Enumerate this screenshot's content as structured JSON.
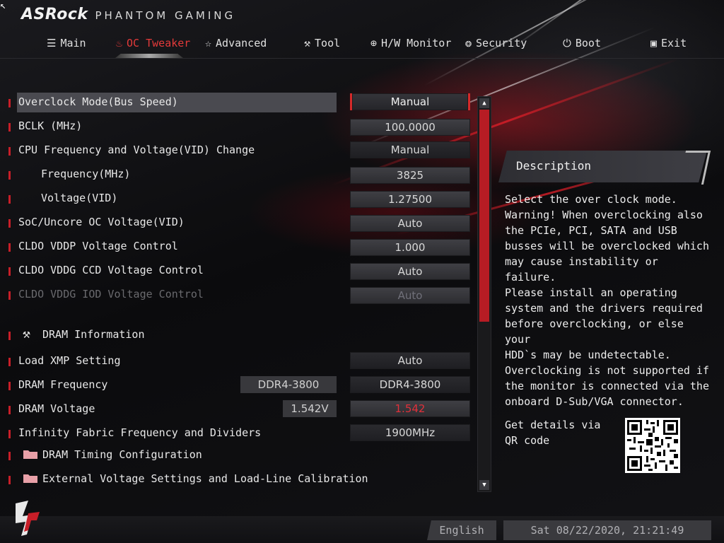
{
  "header": {
    "brand": "ASRock",
    "subtitle": "PHANTOM GAMING"
  },
  "nav": {
    "tabs": [
      {
        "label": "Main",
        "icon": "list-icon"
      },
      {
        "label": "OC Tweaker",
        "icon": "flame-icon",
        "active": true
      },
      {
        "label": "Advanced",
        "icon": "star-icon"
      },
      {
        "label": "Tool",
        "icon": "tools-icon"
      },
      {
        "label": "H/W Monitor",
        "icon": "crosshair-icon"
      },
      {
        "label": "Security",
        "icon": "shield-icon"
      },
      {
        "label": "Boot",
        "icon": "power-icon"
      },
      {
        "label": "Exit",
        "icon": "exit-door-icon"
      }
    ]
  },
  "menu": [
    {
      "label": "Overclock Mode(Bus Speed)",
      "value": "Manual",
      "selected": true
    },
    {
      "label": "BCLK (MHz)",
      "value": "100.0000"
    },
    {
      "label": "CPU Frequency and Voltage(VID) Change",
      "value": "Manual"
    },
    {
      "label": "Frequency(MHz)",
      "value": "3825"
    },
    {
      "label": "Voltage(VID)",
      "value": "1.27500"
    },
    {
      "label": "SoC/Uncore OC Voltage(VID)",
      "value": "Auto"
    },
    {
      "label": "CLDO VDDP Voltage Control",
      "value": "1.000"
    },
    {
      "label": "CLDO VDDG CCD Voltage Control",
      "value": "Auto"
    },
    {
      "label": "CLDO VDDG IOD Voltage Control",
      "value": "Auto",
      "disabled": true
    },
    {
      "label": "DRAM Information",
      "icon": "tools-icon"
    },
    {
      "label": "Load XMP Setting",
      "value": "Auto"
    },
    {
      "label": "DRAM Frequency",
      "info": "DDR4-3800",
      "value": "DDR4-3800"
    },
    {
      "label": "DRAM Voltage",
      "info": "1.542V",
      "value": "1.542"
    },
    {
      "label": "Infinity Fabric Frequency and Dividers",
      "value": "1900MHz"
    },
    {
      "label": "DRAM Timing Configuration",
      "icon": "folder-icon"
    },
    {
      "label": "External Voltage Settings and Load-Line Calibration",
      "icon": "folder-icon"
    }
  ],
  "description": {
    "title": "Description",
    "text": "Select the over clock mode.\nWarning! When overclocking also\nthe PCIe, PCI, SATA and USB\nbusses will be overclocked which\nmay cause instability or failure.\nPlease install an operating\nsystem and the drivers required\nbefore overclocking, or else your\nHDD`s may be undetectable.\nOverclocking is not supported if\nthe monitor is connected via the\nonboard D-Sub/VGA connector.",
    "qr_text": "Get details via QR code"
  },
  "footer": {
    "language": "English",
    "datetime": "Sat 08/22/2020, 21:21:49"
  },
  "colors": {
    "accent": "#d42a2a",
    "text": "#e8e8e8"
  }
}
